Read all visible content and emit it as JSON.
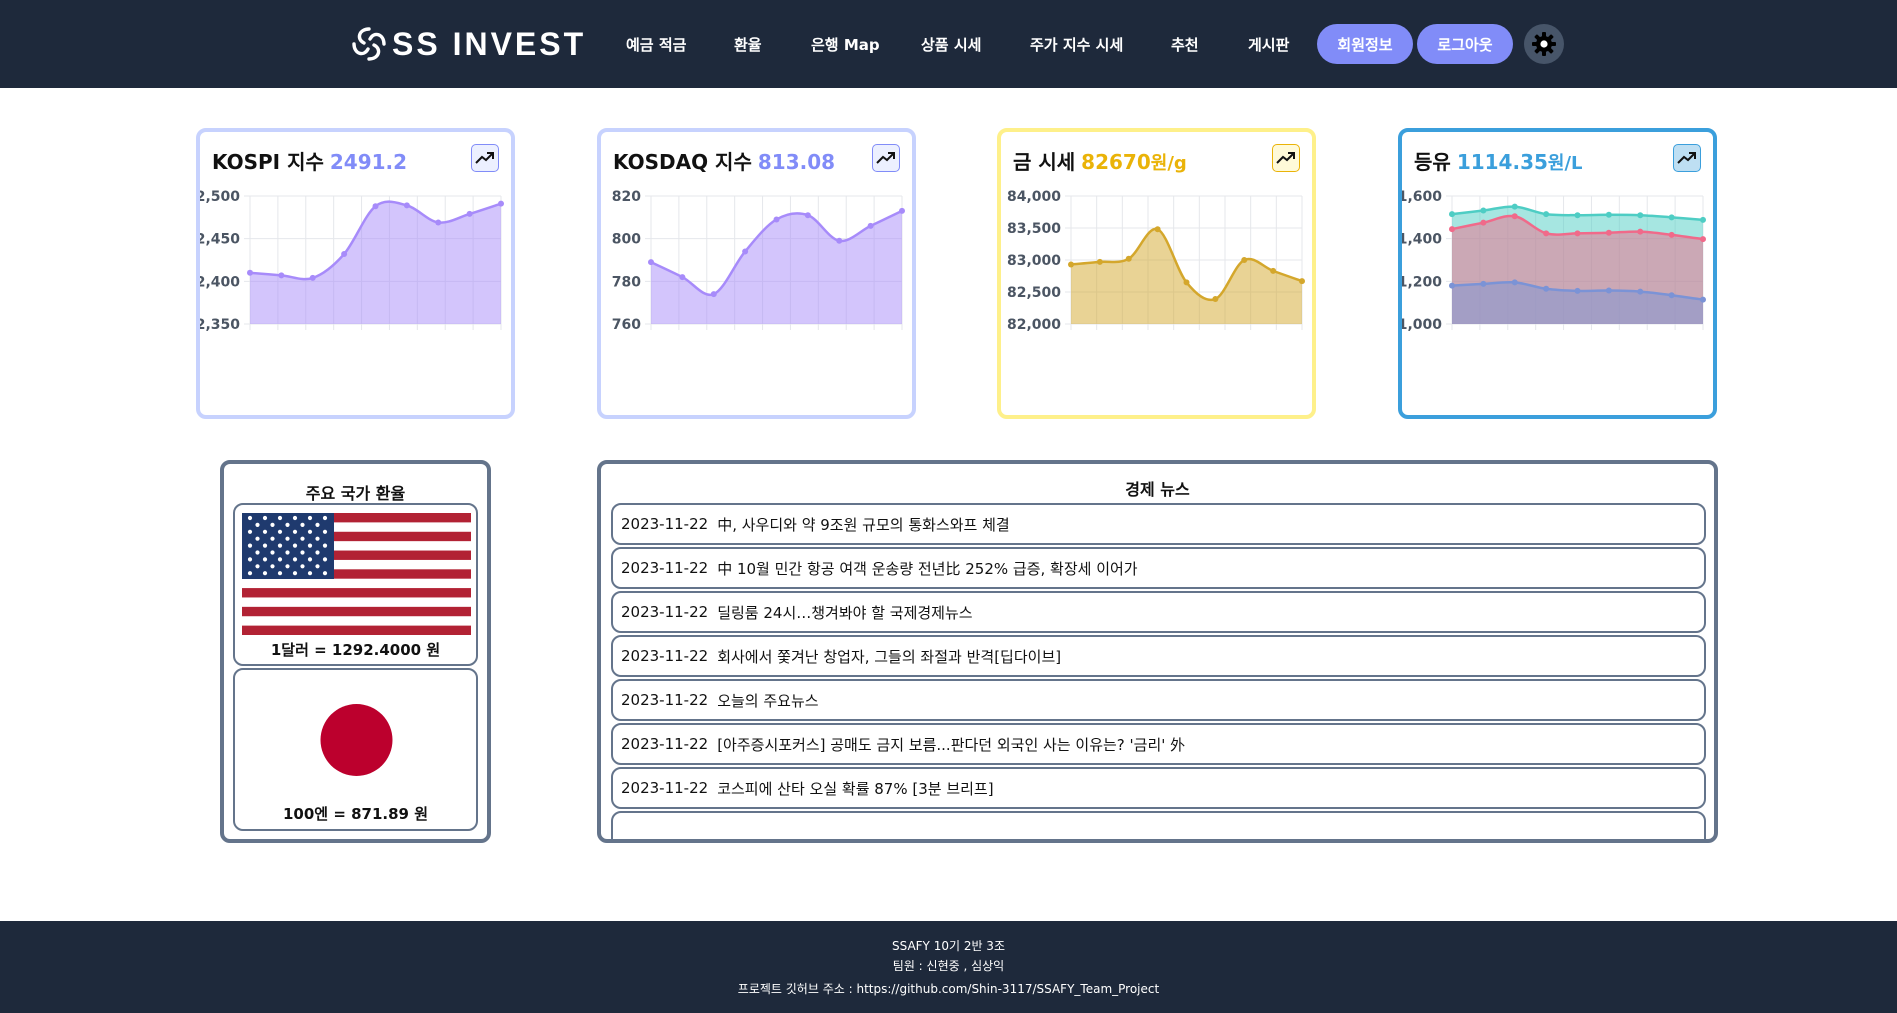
{
  "brand": {
    "name": "SS INVEST"
  },
  "nav": {
    "items": [
      "예금 적금",
      "환율",
      "은행 Map",
      "상품 시세",
      "주가 지수 시세",
      "추천",
      "게시판"
    ],
    "profile_button": "회원정보",
    "logout_button": "로그아웃",
    "theme_toggle_icon": "gear-icon"
  },
  "cards": [
    {
      "label": "KOSPI 지수",
      "value": "2491.2",
      "unit": "",
      "value_color": "#818cf8",
      "border_color": "#c7d2fe",
      "trend_icon": "trending-up-icon"
    },
    {
      "label": "KOSDAQ 지수",
      "value": "813.08",
      "unit": "",
      "value_color": "#818cf8",
      "border_color": "#c7d2fe",
      "trend_icon": "trending-up-icon"
    },
    {
      "label": "금 시세",
      "value": "82670",
      "unit": "원/g",
      "value_color": "#eab308",
      "border_color": "#fef08a",
      "trend_icon": "trending-up-icon"
    },
    {
      "label": "등유",
      "value": "1114.35",
      "unit": "원/L",
      "value_color": "#3b9fdc",
      "border_color": "#3b9fdc",
      "trend_icon": "trending-up-icon"
    }
  ],
  "chart_data": [
    {
      "type": "area",
      "yticks": [
        "2,500",
        "2,450",
        "2,400",
        "2,350"
      ],
      "ylim": [
        2350,
        2500
      ],
      "series": [
        {
          "values": [
            2410,
            2407,
            2404,
            2432,
            2488,
            2489,
            2469,
            2479,
            2491
          ]
        }
      ],
      "colors": [
        "#a78bfa"
      ],
      "grid": true
    },
    {
      "type": "area",
      "yticks": [
        "820",
        "800",
        "780",
        "760"
      ],
      "ylim": [
        760,
        820
      ],
      "series": [
        {
          "values": [
            789,
            782,
            774,
            794,
            809,
            811,
            799,
            806,
            813
          ]
        }
      ],
      "colors": [
        "#a78bfa"
      ],
      "grid": true
    },
    {
      "type": "area",
      "yticks": [
        "84,000",
        "83,500",
        "83,000",
        "82,500",
        "82,000"
      ],
      "ylim": [
        82000,
        84000
      ],
      "series": [
        {
          "values": [
            82930,
            82970,
            83020,
            83480,
            82650,
            82390,
            83000,
            82830,
            82670
          ]
        }
      ],
      "colors": [
        "#d4a72c"
      ],
      "grid": true
    },
    {
      "type": "area",
      "yticks": [
        "1,600",
        "1,400",
        "1,200",
        "1,000"
      ],
      "ylim": [
        1000,
        1600
      ],
      "series": [
        {
          "values": [
            1515,
            1532,
            1550,
            1515,
            1510,
            1512,
            1510,
            1500,
            1488
          ]
        },
        {
          "values": [
            1445,
            1475,
            1505,
            1425,
            1425,
            1428,
            1433,
            1418,
            1398
          ]
        },
        {
          "values": [
            1180,
            1188,
            1195,
            1165,
            1155,
            1157,
            1152,
            1135,
            1114
          ]
        }
      ],
      "colors": [
        "#4ecdc4",
        "#f06a8a",
        "#7b93d6"
      ],
      "grid": true
    }
  ],
  "exchange": {
    "title": "주요 국가 환율",
    "items": [
      {
        "flag_icon": "us-flag-icon",
        "label": "1달러 = 1292.4000 원"
      },
      {
        "flag_icon": "japan-flag-icon",
        "label": "100엔 = 871.89 원"
      }
    ]
  },
  "news": {
    "title": "경제 뉴스",
    "items": [
      {
        "date": "2023-11-22",
        "headline": "中, 사우디와 약 9조원 규모의 통화스와프 체결"
      },
      {
        "date": "2023-11-22",
        "headline": "中 10월 민간 항공 여객 운송량 전년比 252% 급증, 확장세 이어가"
      },
      {
        "date": "2023-11-22",
        "headline": "딜링룸 24시…챙겨봐야 할 국제경제뉴스"
      },
      {
        "date": "2023-11-22",
        "headline": "회사에서 쫓겨난 창업자, 그들의 좌절과 반격[딥다이브]"
      },
      {
        "date": "2023-11-22",
        "headline": "오늘의 주요뉴스"
      },
      {
        "date": "2023-11-22",
        "headline": "[아주증시포커스] 공매도 금지 보름...판다던 외국인 사는 이유는? '금리' 外"
      },
      {
        "date": "2023-11-22",
        "headline": "코스피에 산타 오실 확률 87% [3분 브리프]"
      },
      {
        "date": "",
        "headline": ""
      }
    ]
  },
  "footer": {
    "line1": "SSAFY 10기 2반 3조",
    "line2": "팀원 : 신현중 , 심상익",
    "line3": "프로젝트 깃허브 주소 : https://github.com/Shin-3117/SSAFY_Team_Project"
  }
}
